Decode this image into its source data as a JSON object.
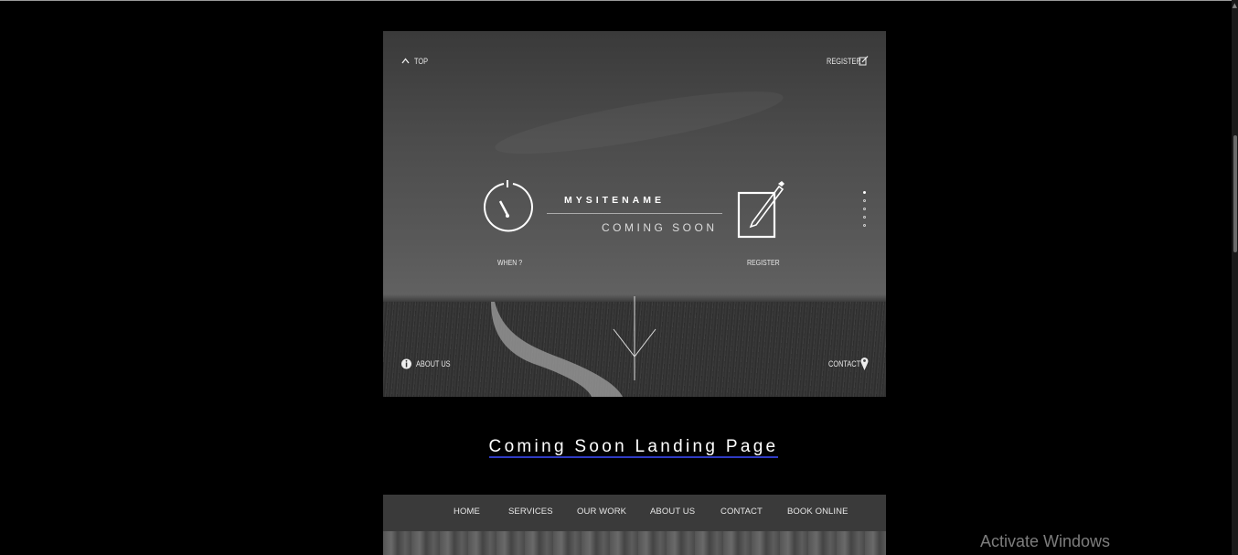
{
  "preview1": {
    "top_link": "TOP",
    "register_link": "REGISTER",
    "brand": "MYSITENAME",
    "tagline": "COMING SOON",
    "when_label": "WHEN ?",
    "register_label": "REGISTER",
    "about_link": "ABOUT US",
    "contact_link": "CONTACT",
    "slide_dots": [
      true,
      false,
      false,
      false,
      false
    ]
  },
  "caption": "Coming Soon Landing Page",
  "preview2": {
    "nav": [
      "HOME",
      "SERVICES",
      "OUR WORK",
      "ABOUT US",
      "CONTACT",
      "BOOK ONLINE"
    ]
  },
  "watermark": "Activate Windows"
}
